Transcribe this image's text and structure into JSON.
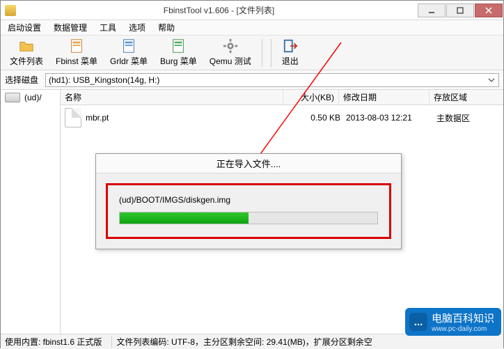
{
  "window": {
    "title": "FbinstTool v1.606 - [文件列表]"
  },
  "menu": {
    "items": [
      "启动设置",
      "数据管理",
      "工具",
      "选项",
      "帮助"
    ]
  },
  "toolbar": {
    "items": [
      {
        "name": "file-list",
        "label": "文件列表",
        "icon": "folder"
      },
      {
        "name": "fbinst-menu",
        "label": "Fbinst 菜单",
        "icon": "sheet-orange"
      },
      {
        "name": "grldr-menu",
        "label": "Grldr 菜单",
        "icon": "sheet-blue"
      },
      {
        "name": "burg-menu",
        "label": "Burg 菜单",
        "icon": "sheet-green"
      },
      {
        "name": "qemu-test",
        "label": "Qemu 测试",
        "icon": "gear"
      },
      {
        "name": "exit",
        "label": "退出",
        "icon": "exit"
      }
    ]
  },
  "disk_selector": {
    "label": "选择磁盘",
    "value": "(hd1): USB_Kingston(14g, H:)"
  },
  "tree": {
    "root_label": "(ud)/"
  },
  "list": {
    "headers": {
      "name": "名称",
      "size": "大小(KB)",
      "date": "修改日期",
      "region": "存放区域"
    },
    "rows": [
      {
        "name": "mbr.pt",
        "size": "0.50 KB",
        "date": "2013-08-03 12:21",
        "region": "主数据区"
      }
    ]
  },
  "dialog": {
    "title": "正在导入文件....",
    "path": "(ud)/BOOT/IMGS/diskgen.img",
    "progress_percent": 50
  },
  "status": {
    "left": "使用内置: fbinst1.6 正式版",
    "right": "文件列表编码: UTF-8，主分区剩余空间:    29.41(MB)，扩展分区剩余空"
  },
  "watermark": {
    "title": "电脑百科知识",
    "url": "www.pc-daily.com"
  }
}
